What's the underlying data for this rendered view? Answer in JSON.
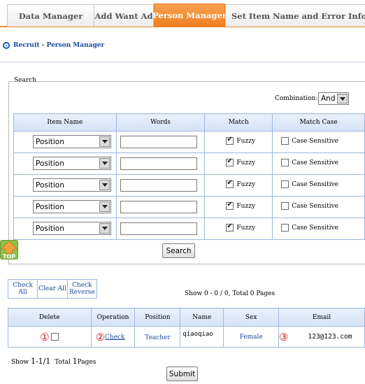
{
  "tabs": [
    {
      "label": "Data Manager",
      "active": false
    },
    {
      "label": "Add Want Ad",
      "active": false
    },
    {
      "label": "Person Manager",
      "active": true
    },
    {
      "label": "Set Item Name and Error Information",
      "active": false
    }
  ],
  "breadcrumb": "Recruit - Person Manager",
  "search": {
    "legend": "Search",
    "combination_label": "Combination:",
    "combination_value": "And",
    "columns": [
      "Item Name",
      "Words",
      "Match",
      "Match Case"
    ],
    "rows": [
      {
        "item": "Position",
        "words": "",
        "fuzzy_label": "Fuzzy",
        "fuzzy": true,
        "case_label": "Case Sensitive",
        "case": false
      },
      {
        "item": "Position",
        "words": "",
        "fuzzy_label": "Fuzzy",
        "fuzzy": true,
        "case_label": "Case Sensitive",
        "case": false
      },
      {
        "item": "Position",
        "words": "",
        "fuzzy_label": "Fuzzy",
        "fuzzy": true,
        "case_label": "Case Sensitive",
        "case": false
      },
      {
        "item": "Position",
        "words": "",
        "fuzzy_label": "Fuzzy",
        "fuzzy": true,
        "case_label": "Case Sensitive",
        "case": false
      },
      {
        "item": "Position",
        "words": "",
        "fuzzy_label": "Fuzzy",
        "fuzzy": true,
        "case_label": "Case Sensitive",
        "case": false
      }
    ],
    "button": "Search"
  },
  "top_icon": {
    "label": "TOP",
    "icon": "back-to-top-icon"
  },
  "bulk": {
    "check_all": "Check All",
    "clear_all": "Clear All",
    "check_reverse": "Check Reverse"
  },
  "showing": "Show 0 - 0 / 0, Total 0 Pages",
  "results": {
    "columns": [
      "Delete",
      "Operation",
      "Position",
      "Name",
      "Sex",
      "Email"
    ],
    "row": {
      "marker1": "①",
      "marker2": "②",
      "marker3": "③",
      "operation": "Check",
      "position": "Teacher",
      "name": "qiaoqiao",
      "sex": "Female",
      "email": "123@123.com"
    }
  },
  "pager": {
    "prefix": "Show",
    "range": "1-1/1",
    "total_prefix": "Total",
    "total_pages": "1",
    "suffix": "Pages"
  },
  "submit": "Submit",
  "colors": {
    "accent": "#ef7f22",
    "link": "#1a4c9c",
    "marker": "#d4171c"
  }
}
